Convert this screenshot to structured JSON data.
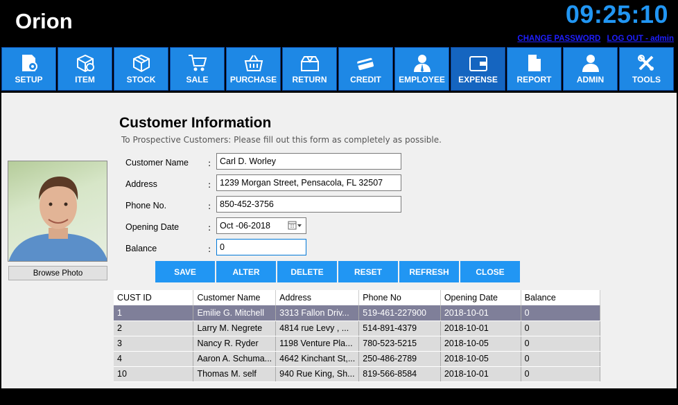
{
  "app": {
    "title": "Orion",
    "clock": "09:25:10"
  },
  "header": {
    "change_password": "CHANGE PASSWORD",
    "logout": "LOG OUT - admin"
  },
  "nav": [
    {
      "label": "SETUP",
      "icon": "setup-icon"
    },
    {
      "label": "ITEM",
      "icon": "item-icon"
    },
    {
      "label": "STOCK",
      "icon": "stock-icon"
    },
    {
      "label": "SALE",
      "icon": "cart-icon"
    },
    {
      "label": "PURCHASE",
      "icon": "basket-icon"
    },
    {
      "label": "RETURN",
      "icon": "return-icon"
    },
    {
      "label": "CREDIT",
      "icon": "credit-card-icon"
    },
    {
      "label": "EMPLOYEE",
      "icon": "employee-icon"
    },
    {
      "label": "EXPENSE",
      "icon": "wallet-icon"
    },
    {
      "label": "REPORT",
      "icon": "report-icon"
    },
    {
      "label": "ADMIN",
      "icon": "admin-icon"
    },
    {
      "label": "TOOLS",
      "icon": "tools-icon"
    }
  ],
  "active_nav": "EXPENSE",
  "form": {
    "title": "Customer Information",
    "subtitle": "To Prospective Customers: Please fill out this form as completely as possible.",
    "browse_label": "Browse Photo",
    "fields": {
      "name": {
        "label": "Customer Name",
        "value": "Carl D. Worley"
      },
      "address": {
        "label": "Address",
        "value": "1239 Morgan Street, Pensacola, FL 32507"
      },
      "phone": {
        "label": "Phone No.",
        "value": "850-452-3756"
      },
      "opening_date": {
        "label": "Opening Date",
        "value": "Oct -06-2018"
      },
      "balance": {
        "label": "Balance",
        "value": "0"
      }
    },
    "colon": ":"
  },
  "buttons": {
    "save": "SAVE",
    "alter": "ALTER",
    "delete": "DELETE",
    "reset": "RESET",
    "refresh": "REFRESH",
    "close": "CLOSE"
  },
  "table": {
    "columns": [
      "CUST ID",
      "Customer Name",
      "Address",
      "Phone No",
      "Opening Date",
      "Balance"
    ],
    "rows": [
      [
        "1",
        "Emilie G. Mitchell",
        "3313 Fallon Driv...",
        "519-461-227900",
        "2018-10-01",
        "0"
      ],
      [
        "2",
        "Larry M. Negrete",
        "4814 rue Levy , ...",
        "514-891-4379",
        "2018-10-01",
        "0"
      ],
      [
        "3",
        "Nancy R. Ryder",
        "1198 Venture Pla...",
        "780-523-5215",
        "2018-10-05",
        "0"
      ],
      [
        "4",
        "Aaron A. Schuma...",
        "4642 Kinchant St,...",
        "250-486-2789",
        "2018-10-05",
        "0"
      ],
      [
        "10",
        "Thomas M. self",
        "940 Rue King, Sh...",
        "819-566-8584",
        "2018-10-01",
        "0"
      ]
    ],
    "selected_row": 0
  },
  "colors": {
    "accent": "#2196f3",
    "nav_bg": "#1e88e5",
    "selected_row": "#7f7f99"
  }
}
